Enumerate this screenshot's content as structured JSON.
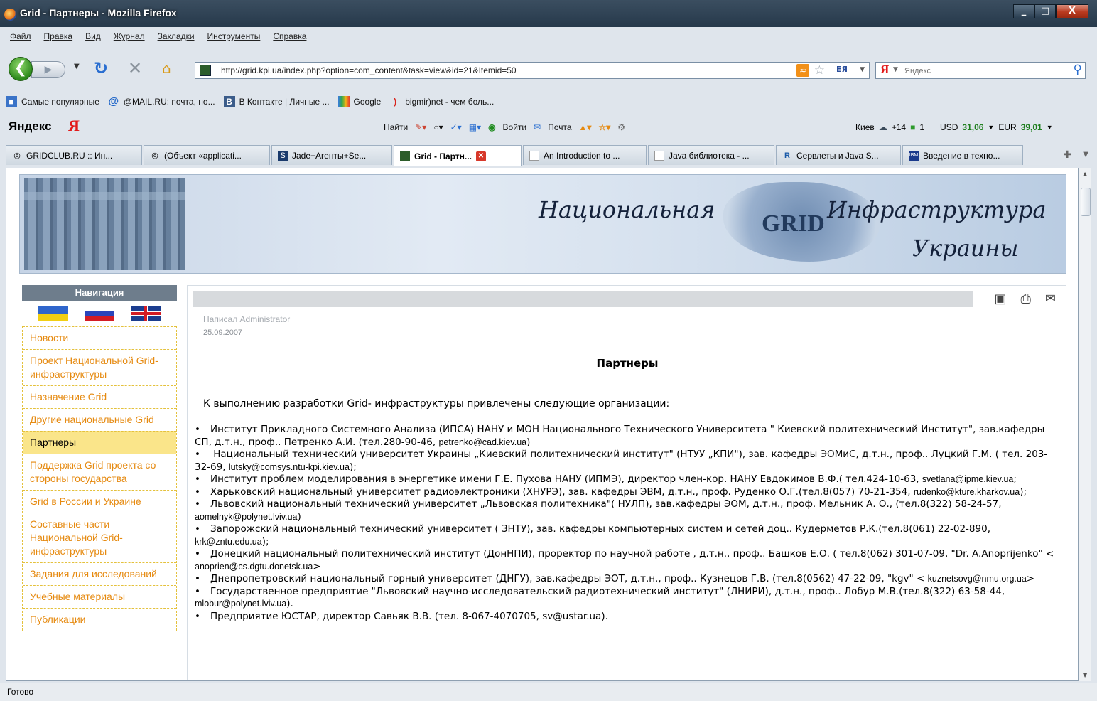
{
  "window": {
    "title": "Grid - Партнеры - Mozilla Firefox",
    "buttons": [
      "_",
      "□",
      "X"
    ]
  },
  "menubar": [
    "Файл",
    "Правка",
    "Вид",
    "Журнал",
    "Закладки",
    "Инструменты",
    "Справка"
  ],
  "navbar": {
    "url": "http://grid.kpi.ua/index.php?option=com_content&task=view&id=21&Itemid=50",
    "search_placeholder": "Яндекс",
    "search_engine_logo": "Я"
  },
  "bookmarks": [
    {
      "label": "Самые популярные",
      "icon": "bookmarks-folder-icon"
    },
    {
      "label": "@MAIL.RU: почта, но...",
      "icon": "mailru-icon"
    },
    {
      "label": "В Контакте | Личные ...",
      "icon": "vkontakte-icon"
    },
    {
      "label": "Google",
      "icon": "google-icon"
    },
    {
      "label": "bigmir)net - чем боль...",
      "icon": "bigmir-icon"
    }
  ],
  "yandexbar": {
    "brand": "Яндекс",
    "logo": "Я",
    "find": "Найти",
    "login": "Войти",
    "mail": "Почта",
    "city": "Киев",
    "temperature": "+14",
    "traffic": "1",
    "usd_label": "USD",
    "usd_value": "31,06",
    "eur_label": "EUR",
    "eur_value": "39,01"
  },
  "tabs": [
    {
      "label": "GRIDCLUB.RU :: Ин...",
      "active": false
    },
    {
      "label": "(Объект «applicati...",
      "active": false
    },
    {
      "label": "Jade+Агенты+Se...",
      "active": false
    },
    {
      "label": "Grid - Партн...",
      "active": true
    },
    {
      "label": "An Introduction to ...",
      "active": false
    },
    {
      "label": "Java библиотека - ...",
      "active": false
    },
    {
      "label": "Сервлеты и Java S...",
      "active": false
    },
    {
      "label": "Введение в техно...",
      "active": false
    }
  ],
  "header": {
    "line1": "Национальная",
    "logo": "GRID",
    "line2": "Инфраструктура",
    "line3": "Украины"
  },
  "sidebar": {
    "title": "Навигация",
    "items": [
      {
        "label": "Новости",
        "active": false
      },
      {
        "label": "Проект Национальной Grid-инфраструктуры",
        "active": false
      },
      {
        "label": "Назначение Grid",
        "active": false
      },
      {
        "label": "Другие национальные Grid",
        "active": false
      },
      {
        "label": "Партнеры",
        "active": true
      },
      {
        "label": "Поддержка Grid проекта со стороны государства",
        "active": false
      },
      {
        "label": "Grid в России и Украине",
        "active": false
      },
      {
        "label": "Составные части Национальной Grid-инфраструктуры",
        "active": false
      },
      {
        "label": "Задания для исследований",
        "active": false
      },
      {
        "label": "Учебные материалы",
        "active": false
      },
      {
        "label": "Публикации",
        "active": false
      }
    ]
  },
  "article": {
    "author": "Написал Administrator",
    "date": "25.09.2007",
    "title": "Партнеры",
    "intro": "К выполнению  разработки Grid- инфраструктуры привлечены следующие организации:",
    "orgs": [
      {
        "text": "Институт Прикладного Системного Анализа (ИПСА) НАНУ и МОН Национального Технического Университета \" Киевский политехнический Институт\", зав.кафедры СП, д.т.н., проф.. Петренко А.И. (тел.280-90-46, ",
        "email": "petrenko@cad.kiev.ua",
        "tail": ")"
      },
      {
        "text": " Национальный технический университет Украины „Киевский политехнический институт\" (НТУУ „КПИ\"), зав. кафедры ЭОМиС, д.т.н., проф.. Луцкий Г.М. ( тел. 203-32-69, ",
        "email": "lutsky@comsys.ntu-kpi.kiev.ua",
        "tail": ");"
      },
      {
        "text": "Институт проблем моделирования в энергетике имени Г.Е. Пухова НАНУ (ИПМЭ), директор член-кор. НАНУ Евдокимов В.Ф.( тел.424-10-63, ",
        "email": "svetlana@ipme.kiev.ua",
        "tail": ";"
      },
      {
        "text": "Харьковский национальный университет радиоэлектроники (ХНУРЭ), зав. кафедры ЭВМ,  д.т.н., проф. Руденко О.Г.(тел.8(057) 70-21-354, ",
        "email": "rudenko@kture.kharkov.ua",
        "tail": ");"
      },
      {
        "text": "Львовский национальный технический университет „Львовская политехника\"( НУЛП), зав.кафедры ЭОМ, д.т.н., проф. Мельник А. О., (тел.8(322) 58-24-57, ",
        "email": "aomelnyk@polynet.lviv.ua",
        "tail": ")"
      },
      {
        "text": "Запорожский национальный технический университет ( ЗНТУ), зав. кафедры компьютерных систем и сетей  доц.. Кудерметов Р.К.(тел.8(061) 22-02-890, ",
        "email": "krk@zntu.edu.ua",
        "tail": ");"
      },
      {
        "text": "Донецкий национальный политехнический институт (ДонНПИ), проректор по научной работе ,  д.т.н., проф.. Башков Е.О. ( тел.8(062) 301-07-09, \"Dr. A.Anoprijenko\" < ",
        "email": "anoprien@cs.dgtu.donetsk.ua",
        "tail": ">"
      },
      {
        "text": "Днепропетровский  национальный горный университет (ДНГУ), зав.кафедры ЭОТ, д.т.н., проф.. Кузнецов Г.В. (тел.8(0562) 47-22-09, \"kgv\" < ",
        "email": "kuznetsovg@nmu.org.ua",
        "tail": ">"
      },
      {
        "text": "Государственное предприятие \"Львовский научно-исследовательский радиотехнический институт\" (ЛНИРИ), д.т.н., проф.. Лобур М.В.(тел.8(322) 63-58-44, ",
        "email": "mlobur@polynet.lviv.ua",
        "tail": ")."
      },
      {
        "text": "Предприятие ЮСТАР, директор  Савьяк В.В. (тел. 8-067-4070705,  sv@ustar.ua).",
        "email": "",
        "tail": ""
      }
    ]
  },
  "status": "Готово",
  "colors": {
    "menu_link": "#e68a10",
    "active_menu_bg": "#fae58a",
    "titlebar": "#2f4357"
  }
}
